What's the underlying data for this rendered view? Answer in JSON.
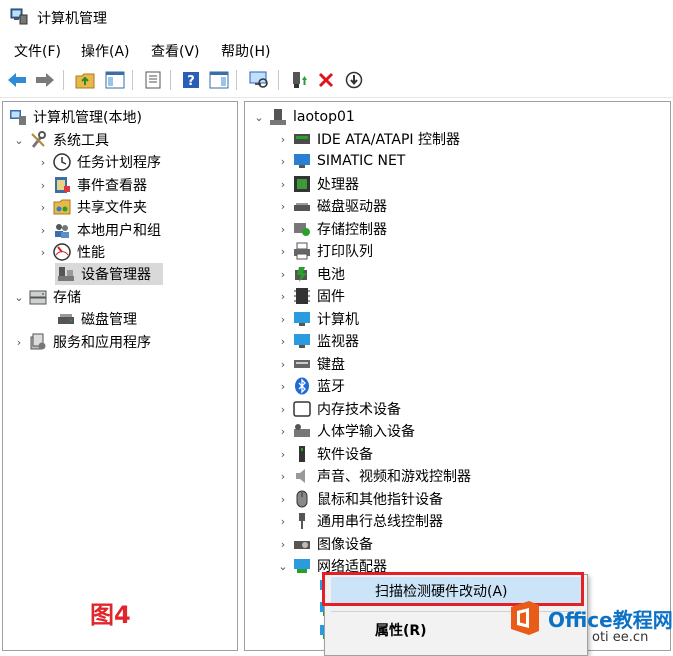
{
  "window": {
    "title": "计算机管理"
  },
  "menu": [
    {
      "label": "文件(F)"
    },
    {
      "label": "操作(A)"
    },
    {
      "label": "查看(V)"
    },
    {
      "label": "帮助(H)"
    }
  ],
  "left_tree": {
    "root": "计算机管理(本地)",
    "system_tools": "系统工具",
    "task_scheduler": "任务计划程序",
    "event_viewer": "事件查看器",
    "shared_folders": "共享文件夹",
    "local_users": "本地用户和组",
    "performance": "性能",
    "device_manager": "设备管理器",
    "storage": "存储",
    "disk_management": "磁盘管理",
    "services_apps": "服务和应用程序"
  },
  "right_tree": {
    "root": "laotop01",
    "items": [
      {
        "label": "IDE ATA/ATAPI 控制器"
      },
      {
        "label": "SIMATIC NET"
      },
      {
        "label": "处理器"
      },
      {
        "label": "磁盘驱动器"
      },
      {
        "label": "存储控制器"
      },
      {
        "label": "打印队列"
      },
      {
        "label": "电池"
      },
      {
        "label": "固件"
      },
      {
        "label": "计算机"
      },
      {
        "label": "监视器"
      },
      {
        "label": "键盘"
      },
      {
        "label": "蓝牙"
      },
      {
        "label": "内存技术设备"
      },
      {
        "label": "人体学输入设备"
      },
      {
        "label": "软件设备"
      },
      {
        "label": "声音、视频和游戏控制器"
      },
      {
        "label": "鼠标和其他指针设备"
      },
      {
        "label": "通用串行总线控制器"
      },
      {
        "label": "图像设备"
      },
      {
        "label": "网络适配器"
      }
    ]
  },
  "context_menu": {
    "scan": "扫描检测硬件改动(A)",
    "properties": "属性(R)"
  },
  "figure_label": "图4",
  "watermark": {
    "brand": "Office教程网",
    "sub": "oti ee.cn"
  },
  "colors": {
    "highlight_border": "#e41f25",
    "figure_label": "#e0252b",
    "brand": "#0b72c6"
  }
}
